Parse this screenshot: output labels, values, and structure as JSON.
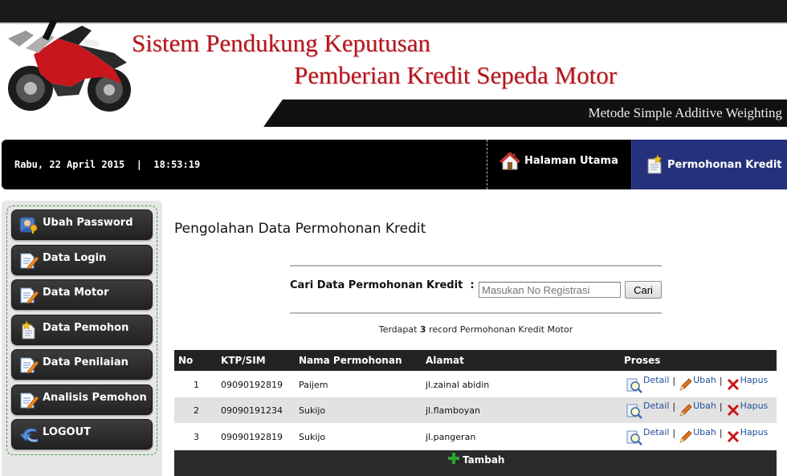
{
  "header": {
    "title_line1": "Sistem Pendukung Keputusan",
    "title_line2": "Pemberian Kredit Sepeda Motor",
    "subtitle": "Metode Simple Additive Weighting"
  },
  "navbar": {
    "datetime": "Rabu, 22 April 2015  |  18:53:19",
    "tabs": [
      {
        "label": "Halaman Utama",
        "icon": "house-icon"
      },
      {
        "label": "Permohonan Kredit",
        "icon": "document-star-icon",
        "active": true
      }
    ]
  },
  "sidebar": {
    "items": [
      {
        "label": "Ubah Password",
        "icon": "user-key-icon"
      },
      {
        "label": "Data Login",
        "icon": "document-edit-icon"
      },
      {
        "label": "Data Motor",
        "icon": "document-edit-icon"
      },
      {
        "label": "Data Pemohon",
        "icon": "document-star-icon"
      },
      {
        "label": "Data Penilaian",
        "icon": "document-edit-icon"
      },
      {
        "label": "Analisis Pemohon",
        "icon": "document-edit-icon"
      },
      {
        "label": "LOGOUT",
        "icon": "logout-arrow-icon"
      }
    ]
  },
  "main": {
    "heading": "Pengolahan Data Permohonan Kredit",
    "search": {
      "label": "Cari Data Permohonan Kredit  :",
      "placeholder": "Masukan No Registrasi",
      "button": "Cari"
    },
    "record_count": {
      "prefix": "Terdapat ",
      "count": "3",
      "suffix": " record Permohonan Kredit Motor"
    },
    "table": {
      "columns": [
        "No",
        "KTP/SIM",
        "Nama Permohonan",
        "Alamat",
        "Proses"
      ],
      "rows": [
        {
          "no": "1",
          "ktp": "09090192819",
          "nama": "Paijem",
          "alamat": "jl.zainal abidin"
        },
        {
          "no": "2",
          "ktp": "09090191234",
          "nama": "Sukijo",
          "alamat": "jl.flamboyan"
        },
        {
          "no": "3",
          "ktp": "09090192819",
          "nama": "Sukijo",
          "alamat": "jl.pangeran"
        }
      ],
      "actions": {
        "detail": "Detail",
        "ubah": "Ubah",
        "hapus": "Hapus",
        "separator": "|"
      },
      "add_button": "Tambah"
    }
  },
  "colors": {
    "title_red": "#b3151b",
    "active_tab": "#25317a",
    "link_blue": "#1f4f9a",
    "add_green": "#2fa52f"
  }
}
